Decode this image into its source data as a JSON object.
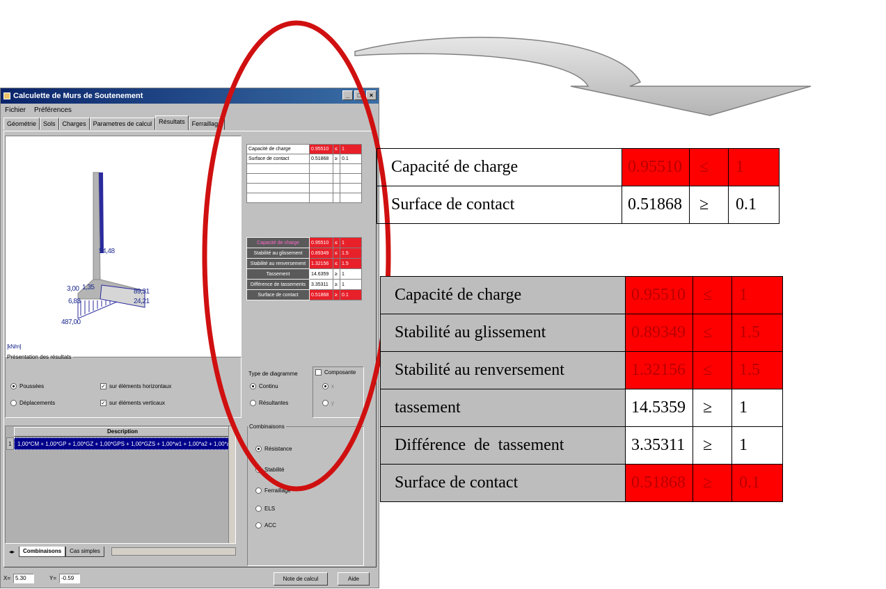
{
  "window": {
    "title": "Calculette de Murs de Soutenement",
    "menu": [
      "Fichier",
      "Préférences"
    ],
    "tabs": [
      "Géométrie",
      "Sols",
      "Charges",
      "Parametres de calcul",
      "Résultats",
      "Ferraillage"
    ],
    "active_tab": "Résultats"
  },
  "diagram": {
    "unit": "[kN/m]",
    "labels": [
      "54,48",
      "3,00",
      "1,35",
      "6,83",
      "89,31",
      "24,21",
      "487,00"
    ]
  },
  "small_table_1": {
    "rows": [
      {
        "label": "Capacité de charge",
        "value": "0.95510",
        "op": "≤",
        "limit": "1"
      },
      {
        "label": "Surface de contact",
        "value": "0.51868",
        "op": "≥",
        "limit": "0.1"
      }
    ]
  },
  "small_table_2": {
    "rows": [
      {
        "label": "Capacité de charge",
        "value": "0.95510",
        "op": "≤",
        "limit": "1"
      },
      {
        "label": "Stabilité au glissement",
        "value": "0.89349",
        "op": "≤",
        "limit": "1.5"
      },
      {
        "label": "Stabilité au renversement",
        "value": "1.32156",
        "op": "≤",
        "limit": "1.5"
      },
      {
        "label": "Tassement",
        "value": "14.6359",
        "op": "≥",
        "limit": "1"
      },
      {
        "label": "Différence de tassements",
        "value": "3.35311",
        "op": "≥",
        "limit": "1"
      },
      {
        "label": "Surface de contact",
        "value": "0.51868",
        "op": "≥",
        "limit": "0.1"
      }
    ]
  },
  "presentation": {
    "legend": "Présentation des résultats",
    "options": [
      "Poussées",
      "Déplacements"
    ],
    "selected": "Poussées",
    "checks": [
      "sur éléments horizontaux",
      "sur éléments verticaux"
    ]
  },
  "diagram_type": {
    "legend": "Type de diagramme",
    "options": [
      "Continu",
      "Résultantes"
    ],
    "selected": "Continu",
    "composante_label": "Composante",
    "composante_options": [
      "x",
      "y"
    ]
  },
  "combinaisons": {
    "legend": "Combinaisons",
    "options": [
      "Résistance",
      "Stabilité",
      "Ferraillage",
      "ELS",
      "ACC"
    ],
    "selected": "Résistance"
  },
  "grid": {
    "header": "Description",
    "row_number": "1",
    "row_text": "1,00*CM + 1,00*GP + 1,00*GZ + 1,00*GPS + 1,00*GZS + 1,00*w1 + 1,00*a2 + 1,00*a3 + 1,00",
    "sheet_tabs": [
      "Combinaisons",
      "Cas simples"
    ]
  },
  "status": {
    "x_label": "X=",
    "x_value": "5.30",
    "y_label": "Y=",
    "y_value": "-0.59",
    "btn_note": "Note de calcul",
    "btn_help": "Aide"
  },
  "big_table_1": {
    "rows": [
      {
        "label": "Capacité de charge",
        "value": "0.95510",
        "op": "≤",
        "limit": "1"
      },
      {
        "label": "Surface de contact",
        "value": "0.51868",
        "op": "≥",
        "limit": "0.1"
      }
    ]
  },
  "big_table_2": {
    "rows": [
      {
        "label": "Capacité de charge",
        "value": "0.95510",
        "op": "≤",
        "limit": "1"
      },
      {
        "label": "Stabilité au glissement",
        "value": "0.89349",
        "op": "≤",
        "limit": "1.5"
      },
      {
        "label": "Stabilité au renversement",
        "value": "1.32156",
        "op": "≤",
        "limit": "1.5"
      },
      {
        "label": "tassement",
        "value": "14.5359",
        "op": "≥",
        "limit": "1"
      },
      {
        "label": "Différence  de  tassement",
        "value": "3.35311",
        "op": "≥",
        "limit": "1"
      },
      {
        "label": "Surface de contact",
        "value": "0.51868",
        "op": "≥",
        "limit": "0.1"
      }
    ]
  },
  "colors": {
    "fail_red": "#ff0000",
    "label_grey": "#bdbdbd",
    "ellipse_red": "#d01010",
    "arrow_grey": "#c8c8c8",
    "title_blue": "#0a246a"
  }
}
